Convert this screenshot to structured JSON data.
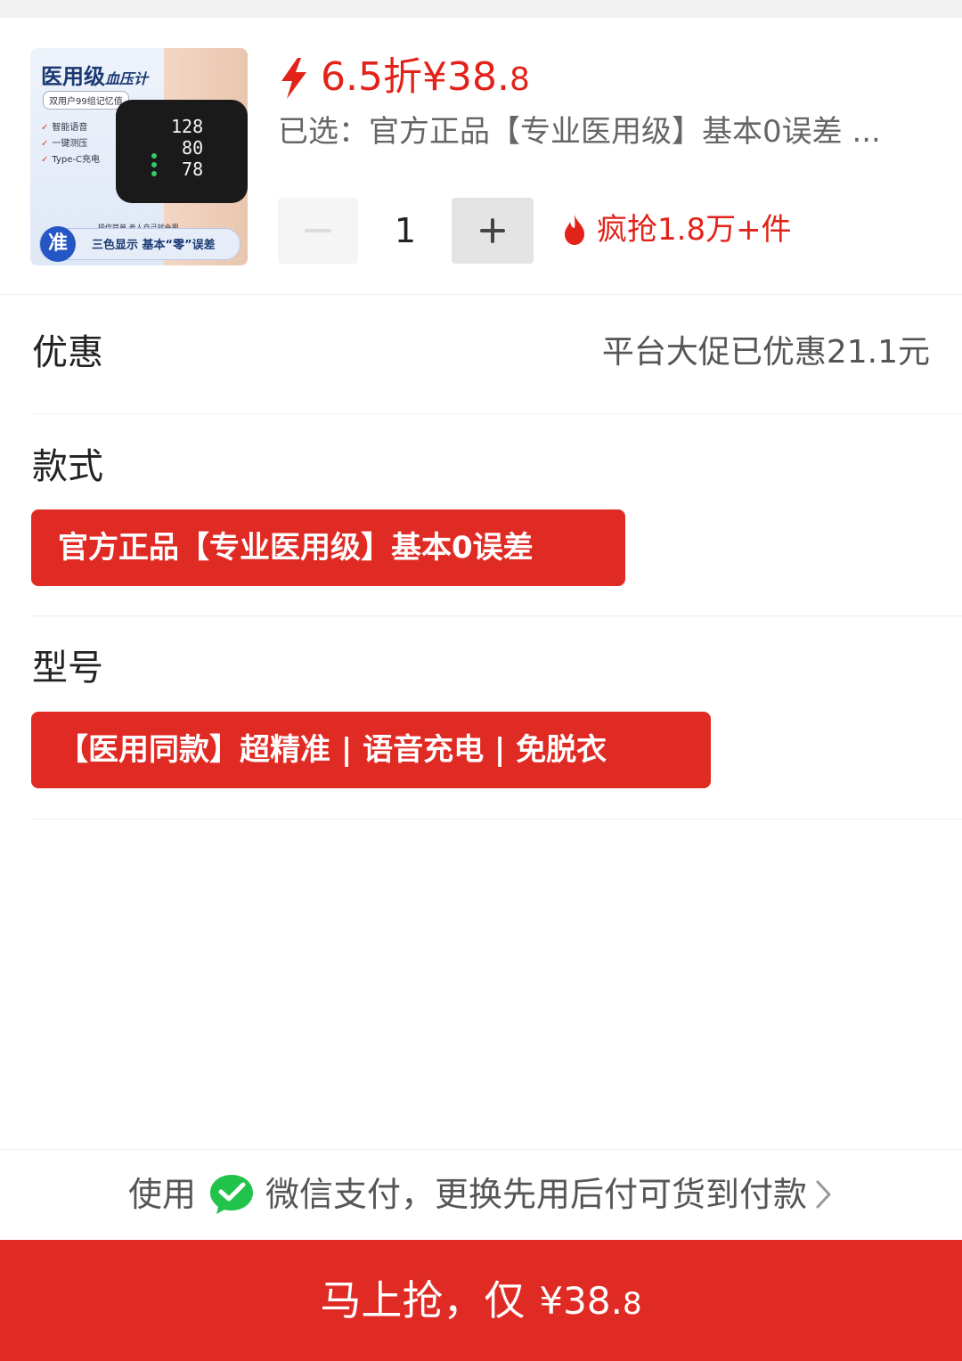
{
  "product": {
    "thumb": {
      "title": "医用级",
      "subtitle": "血压计",
      "memory_note": "双用户99组记忆值",
      "features": [
        "智能语音",
        "一键测压",
        "Type-C充电"
      ],
      "screen_values": [
        "128",
        "80",
        "78"
      ],
      "bottom_note": "操作简单 老人自己就会用",
      "badge": "准",
      "bar_text": "三色显示  基本“零”误差"
    },
    "price_main": "6.5折¥38.",
    "price_decimal": "8",
    "selected_text": "已选：官方正品【专业医用级】基本0误差 ...",
    "quantity": "1",
    "hot_text": "疯抢1.8万+件"
  },
  "discount": {
    "label": "优惠",
    "value": "平台大促已优惠21.1元"
  },
  "style": {
    "label": "款式",
    "option": "官方正品【专业医用级】基本0误差"
  },
  "model": {
    "label": "型号",
    "option": "【医用同款】超精准 | 语音充电 | 免脱衣"
  },
  "payment": {
    "prefix": "使用",
    "text": "微信支付，更换先用后付可货到付款"
  },
  "buy_button": {
    "label": "马上抢，仅",
    "price_main": "¥38.",
    "price_decimal": "8"
  },
  "colors": {
    "accent_red": "#e02b25",
    "price_red": "#e2231a",
    "wechat_green": "#22c34a"
  },
  "icons": [
    "bolt-icon",
    "minus-icon",
    "plus-icon",
    "fire-icon",
    "wechat-icon",
    "chevron-right-icon"
  ]
}
